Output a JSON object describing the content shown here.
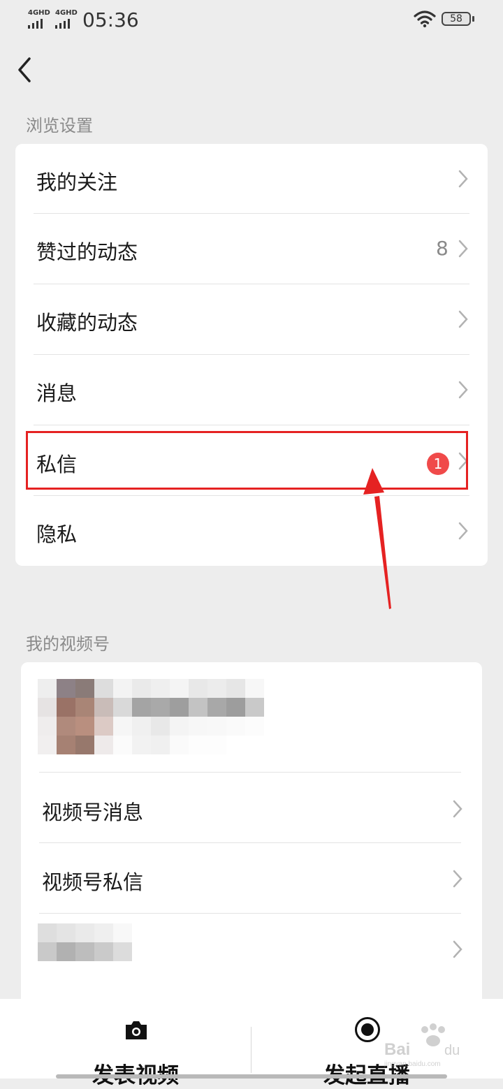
{
  "status_bar": {
    "signal_1": "4GHD",
    "signal_2": "4GHD",
    "time": "05:36",
    "battery": "58"
  },
  "browse_section": {
    "title": "浏览设置",
    "items": [
      {
        "label": "我的关注"
      },
      {
        "label": "赞过的动态",
        "count": "8"
      },
      {
        "label": "收藏的动态"
      },
      {
        "label": "消息"
      },
      {
        "label": "私信",
        "badge": "1"
      },
      {
        "label": "隐私"
      }
    ]
  },
  "channel_section": {
    "title": "我的视频号",
    "items": [
      {
        "label": "视频号消息"
      },
      {
        "label": "视频号私信"
      }
    ]
  },
  "bottom_bar": {
    "post_video_label": "发表视频",
    "go_live_label": "发起直播"
  },
  "colors": {
    "background": "#ededed",
    "card": "#ffffff",
    "badge": "#f04a4a",
    "highlight": "#e52222"
  },
  "icons": [
    "chevron-left-icon",
    "chevron-right-icon",
    "camera-icon",
    "live-record-icon",
    "wifi-icon",
    "battery-icon"
  ]
}
